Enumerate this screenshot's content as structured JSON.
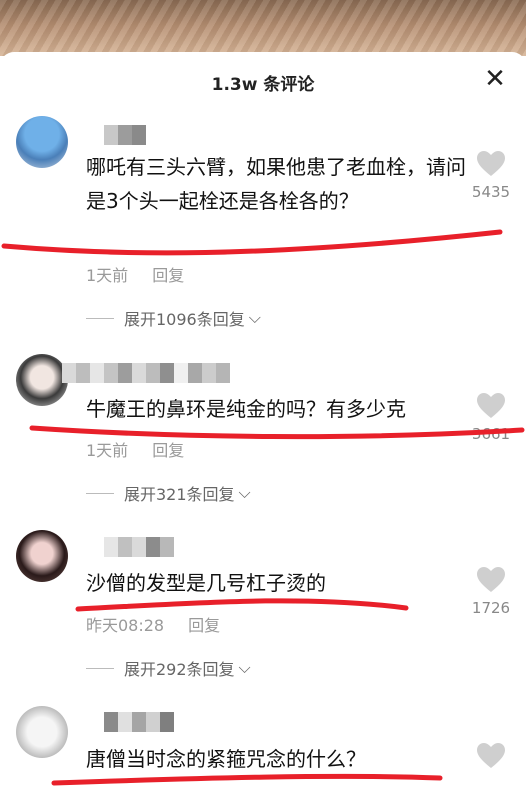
{
  "header": {
    "title": "1.3w 条评论",
    "close_icon": "close-icon"
  },
  "comments": [
    {
      "text": "哪吒有三头六臂，如果他患了老血栓，请问是3个头一起栓还是各栓各的？",
      "time": "1天前",
      "reply_label": "回复",
      "expand_label": "展开1096条回复",
      "likes": "5435"
    },
    {
      "text": "牛魔王的鼻环是纯金的吗？有多少克",
      "time": "1天前",
      "reply_label": "回复",
      "expand_label": "展开321条回复",
      "likes": "3661"
    },
    {
      "text": "沙僧的发型是几号杠子烫的",
      "time": "昨天08:28",
      "reply_label": "回复",
      "expand_label": "展开292条回复",
      "likes": "1726"
    },
    {
      "text": "唐僧当时念的紧箍咒念的什么？",
      "time": "",
      "reply_label": "",
      "expand_label": "",
      "likes": ""
    }
  ],
  "colors": {
    "underline": "#e8202a",
    "muted": "#9a9a9a",
    "heart": "#cfcfcf"
  }
}
